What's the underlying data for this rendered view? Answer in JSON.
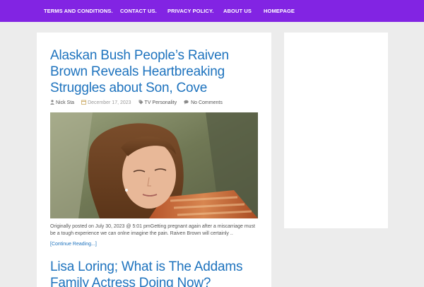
{
  "nav": {
    "items": [
      {
        "label": "TERMS AND CONDITIONS."
      },
      {
        "label": "CONTACT US."
      },
      {
        "label": "PRIVACY POLICY."
      },
      {
        "label": "ABOUT US"
      },
      {
        "label": "HOMEPAGE"
      }
    ]
  },
  "posts": [
    {
      "title": "Alaskan Bush People’s Raiven Brown Reveals Heartbreaking Struggles about Son, Cove",
      "author": "Nick Sta",
      "date": "December 17, 2023",
      "category": "TV Personality",
      "comments": "No Comments",
      "excerpt": "Originally posted on July 30, 2023 @ 5:01 pmGetting pregnant again after a miscarriage must be a tough experience we can onlne imagine the pain. Raiven Brown will certainly ..",
      "read_more": "[Continue Reading...]"
    },
    {
      "title": "Lisa Loring; What is The Addams Family Actress Doing Now?"
    }
  ],
  "icons": {
    "author": "user-icon",
    "date": "calendar-icon",
    "category": "tag-icon",
    "comments": "comments-icon"
  },
  "colors": {
    "nav_bg": "#8224e3",
    "title": "#1e73be",
    "page_bg": "#ececec"
  }
}
